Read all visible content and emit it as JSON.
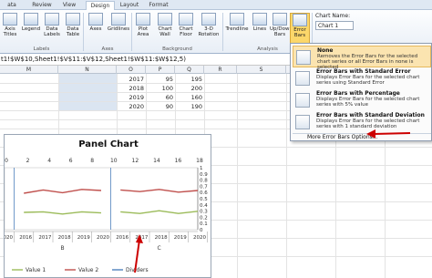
{
  "tabs": [
    "ata",
    "Review",
    "View",
    "Design",
    "Layout",
    "Format"
  ],
  "ribbon": {
    "buttons": [
      {
        "l1": "Axis",
        "l2": "Titles"
      },
      {
        "l1": "Legend",
        "l2": ""
      },
      {
        "l1": "Data",
        "l2": "Labels"
      },
      {
        "l1": "Data",
        "l2": "Table"
      },
      {
        "l1": "Axes",
        "l2": ""
      },
      {
        "l1": "Gridlines",
        "l2": ""
      },
      {
        "l1": "Plot",
        "l2": "Area"
      },
      {
        "l1": "Chart",
        "l2": "Wall"
      },
      {
        "l1": "Chart",
        "l2": "Floor"
      },
      {
        "l1": "3-D",
        "l2": "Rotation"
      },
      {
        "l1": "Trendline",
        "l2": ""
      },
      {
        "l1": "Lines",
        "l2": ""
      },
      {
        "l1": "Up/Down",
        "l2": "Bars"
      },
      {
        "l1": "Error",
        "l2": "Bars"
      }
    ],
    "groups": [
      "Labels",
      "Axes",
      "Background",
      "Analysis"
    ],
    "chart_name_label": "Chart Name:",
    "chart_name_value": "Chart 1"
  },
  "formula": "t1!$W$10,Sheet1!$V$11:$V$12,Sheet1!$W$11:$W$12,5)",
  "columns": [
    "M",
    "N",
    "O",
    "P",
    "Q",
    "R",
    "S",
    "T",
    "U",
    "V"
  ],
  "table": [
    {
      "year": "2017",
      "v1": "95",
      "v2": "195"
    },
    {
      "year": "2018",
      "v1": "100",
      "v2": "200"
    },
    {
      "year": "2019",
      "v1": "60",
      "v2": "160"
    },
    {
      "year": "2020",
      "v1": "90",
      "v2": "190"
    }
  ],
  "chart": {
    "title": "Panel Chart",
    "top_ticks": [
      "0",
      "2",
      "4",
      "6",
      "8",
      "10",
      "12",
      "14",
      "16",
      "18"
    ],
    "right_ticks": [
      "1",
      "0.9",
      "0.8",
      "0.7",
      "0.6",
      "0.5",
      "0.4",
      "0.3",
      "0.2",
      "0.1",
      "0"
    ],
    "x_labels": [
      "2020",
      "2016",
      "2017",
      "2018",
      "2019",
      "2020",
      "2016",
      "2017",
      "2018",
      "2019",
      "2020"
    ],
    "groups": [
      "B",
      "C"
    ],
    "legend": [
      "Value 1",
      "Value 2",
      "Dividers"
    ],
    "colors": {
      "value1": "#9bbb59",
      "value2": "#c0504d",
      "dividers": "#4f81bd",
      "arrow": "#cc0000"
    }
  },
  "chart_data": {
    "type": "line",
    "x": [
      "2020",
      "2016",
      "2017",
      "2018",
      "2019",
      "2020",
      "2016",
      "2017",
      "2018",
      "2019",
      "2020"
    ],
    "series": [
      {
        "name": "Value 2",
        "values": [
          0.62,
          0.6,
          0.66,
          0.61,
          0.67,
          0.65,
          0.66,
          0.63,
          0.67,
          0.62,
          0.65
        ]
      },
      {
        "name": "Value 1",
        "values": [
          0.27,
          0.25,
          0.26,
          0.22,
          0.26,
          0.24,
          0.26,
          0.23,
          0.28,
          0.23,
          0.27
        ]
      }
    ],
    "title": "Panel Chart",
    "ylim": [
      0,
      1
    ]
  },
  "dropdown": {
    "items": [
      {
        "title": "None",
        "desc": "Removes the Error Bars for the selected chart series or all Error Bars in none is selected"
      },
      {
        "title": "Error Bars with Standard Error",
        "desc": "Displays Error Bars for the selected chart series using Standard Error"
      },
      {
        "title": "Error Bars with Percentage",
        "desc": "Displays Error Bars for the selected chart series with 5% value"
      },
      {
        "title": "Error Bars with Standard Deviation",
        "desc": "Displays Error Bars for the selected chart series with 1 standard deviation"
      }
    ],
    "more": "More Error Bars Options..."
  }
}
